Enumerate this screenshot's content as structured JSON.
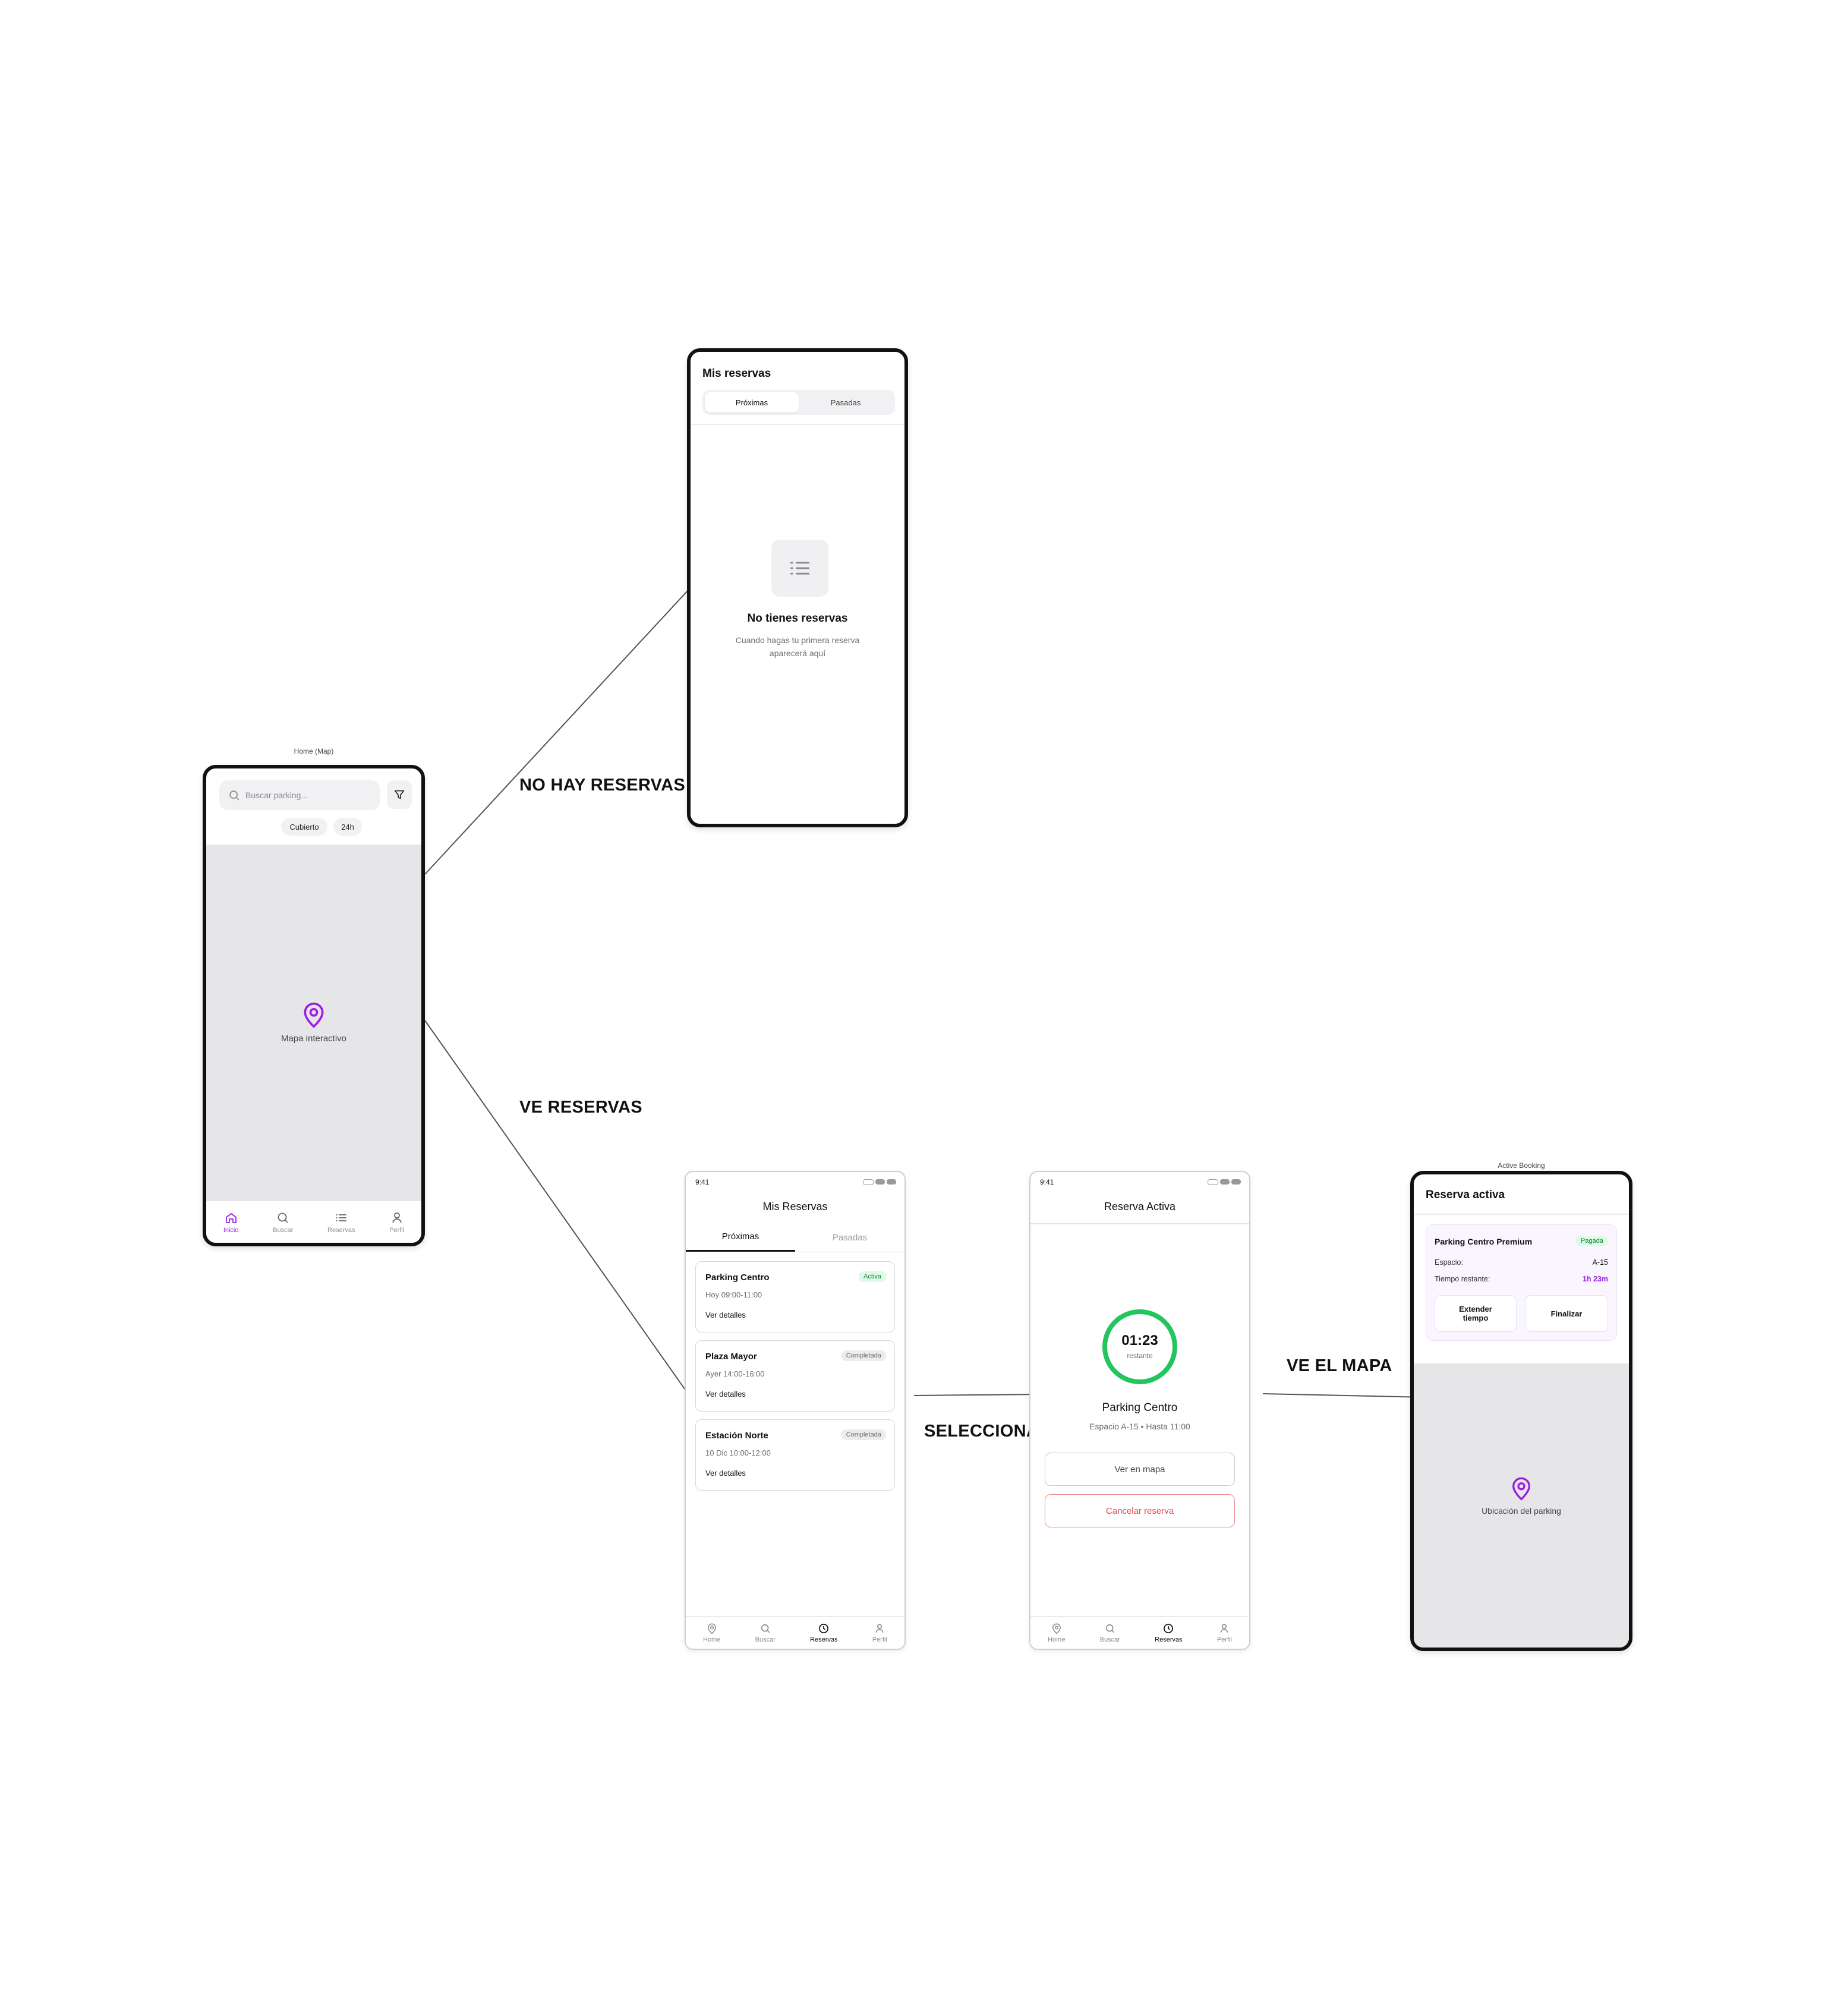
{
  "flow_labels": {
    "no_reservations": "NO HAY RESERVAS",
    "sees_reservations": "VE RESERVAS",
    "selects": "SELECCIONA",
    "sees_map": "VE EL MAPA"
  },
  "home": {
    "caption": "Home (Map)",
    "search_placeholder": "Buscar parking...",
    "chips": [
      "Cubierto",
      "24h"
    ],
    "map_label": "Mapa interactivo",
    "tabs": [
      "Inicio",
      "Buscar",
      "Reservas",
      "Perfil"
    ]
  },
  "empty_reservations": {
    "title": "Mis reservas",
    "tabs": [
      "Próximas",
      "Pasadas"
    ],
    "empty_title": "No tienes reservas",
    "empty_text_1": "Cuando hagas tu primera reserva",
    "empty_text_2": "aparecerá aquí"
  },
  "reservations_list": {
    "time": "9:41",
    "title": "Mis Reservas",
    "tabs": [
      "Próximas",
      "Pasadas"
    ],
    "items": [
      {
        "name": "Parking Centro",
        "when": "Hoy 09:00-11:00",
        "status": "Activa",
        "link": "Ver detalles"
      },
      {
        "name": "Plaza Mayor",
        "when": "Ayer 14:00-16:00",
        "status": "Completada",
        "link": "Ver detalles"
      },
      {
        "name": "Estación Norte",
        "when": "10 Dic 10:00-12:00",
        "status": "Completada",
        "link": "Ver detalles"
      }
    ],
    "nav": [
      "Home",
      "Buscar",
      "Reservas",
      "Perfil"
    ]
  },
  "active_reservation": {
    "time": "9:41",
    "title": "Reserva Activa",
    "timer": "01:23",
    "timer_sub": "restante",
    "timer_progress": 1.0,
    "parking": "Parking Centro",
    "detail": "Espacio A-15 • Hasta 11:00",
    "map_button": "Ver en mapa",
    "cancel_button": "Cancelar reserva",
    "nav": [
      "Home",
      "Buscar",
      "Reservas",
      "Perfil"
    ]
  },
  "active_booking": {
    "caption": "Active Booking",
    "title": "Reserva activa",
    "parking": "Parking Centro Premium",
    "status": "Pagada",
    "space_label": "Espacio:",
    "space_value": "A-15",
    "time_label": "Tiempo restante:",
    "time_value": "1h 23m",
    "extend_line1": "Extender",
    "extend_line2": "tiempo",
    "finish": "Finalizar",
    "map_label": "Ubicación del parking"
  },
  "colors": {
    "accent": "#9a1fe0",
    "success": "#22c55e",
    "danger": "#ef4444"
  }
}
